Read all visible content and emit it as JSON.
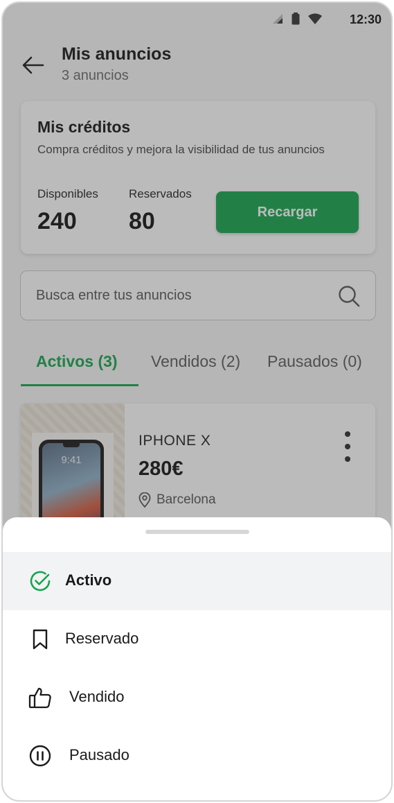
{
  "status_bar": {
    "time": "12:30"
  },
  "header": {
    "title": "Mis anuncios",
    "subtitle": "3 anuncios"
  },
  "credits": {
    "title": "Mis créditos",
    "description": "Compra créditos y mejora la visibilidad de tus anuncios",
    "available_label": "Disponibles",
    "available_value": "240",
    "reserved_label": "Reservados",
    "reserved_value": "80",
    "recharge_label": "Recargar"
  },
  "search": {
    "placeholder": "Busca entre tus anuncios"
  },
  "tabs": [
    {
      "label": "Activos (3)",
      "active": true
    },
    {
      "label": "Vendidos (2)",
      "active": false
    },
    {
      "label": "Pausados (0)",
      "active": false
    }
  ],
  "listing": {
    "name": "IPHONE X",
    "price": "280€",
    "location": "Barcelona",
    "phone_screen_time": "9:41"
  },
  "status_sheet": {
    "options": [
      {
        "label": "Activo",
        "icon": "check-circle-icon",
        "selected": true
      },
      {
        "label": "Reservado",
        "icon": "bookmark-icon",
        "selected": false
      },
      {
        "label": "Vendido",
        "icon": "thumbs-up-icon",
        "selected": false
      },
      {
        "label": "Pausado",
        "icon": "pause-circle-icon",
        "selected": false
      }
    ]
  },
  "colors": {
    "accent": "#14a54e",
    "text": "#1f1f1f",
    "muted": "#6a6a6a"
  }
}
